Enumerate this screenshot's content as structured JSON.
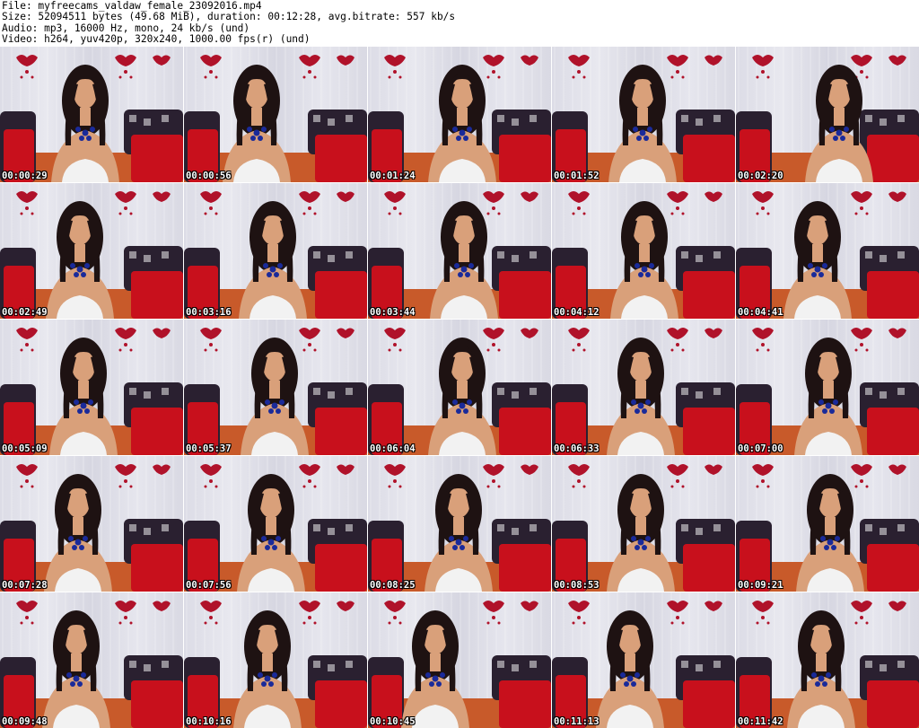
{
  "header": {
    "line1": "File: myfreecams_valdaw_female_23092016.mp4",
    "line2": "Size: 52094511 bytes (49.68 MiB), duration: 00:12:28, avg.bitrate: 557 kb/s",
    "line3": "Audio: mp3, 16000 Hz, mono, 24 kb/s (und)",
    "line4": "Video: h264, yuv420p, 320x240, 1000.00 fps(r) (und)"
  },
  "thumbnails": [
    "00:00:29",
    "00:00:56",
    "00:01:24",
    "00:01:52",
    "00:02:20",
    "00:02:49",
    "00:03:16",
    "00:03:44",
    "00:04:12",
    "00:04:41",
    "00:05:09",
    "00:05:37",
    "00:06:04",
    "00:06:33",
    "00:07:00",
    "00:07:28",
    "00:07:56",
    "00:08:25",
    "00:08:53",
    "00:09:21",
    "00:09:48",
    "00:10:16",
    "00:10:45",
    "00:11:13",
    "00:11:42"
  ],
  "colors": {
    "wall": "#dcdce6",
    "pillow_red": "#c8101c",
    "pillow_dark": "#2a2030",
    "decor_red": "#b0122a",
    "skin": "#d9a07a",
    "hair": "#1e1212",
    "necklace": "#1a2a9a"
  }
}
